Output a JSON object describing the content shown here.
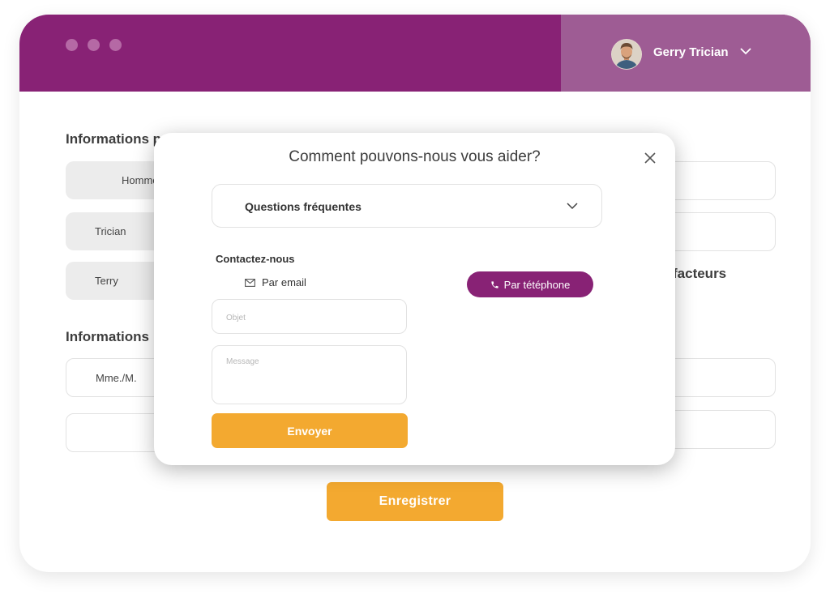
{
  "header": {
    "user_name": "Gerry Trician"
  },
  "form": {
    "section_personal_partial": "Informations p",
    "section_other_partial": "Informations",
    "section_right_partial": "facteurs",
    "fields": {
      "gender": "Homme",
      "last_name": "Trician",
      "first_name": "Terry",
      "civility": "Mme./M."
    },
    "save_label": "Enregistrer"
  },
  "modal": {
    "title": "Comment pouvons-nous vous aider?",
    "faq_label": "Questions fréquentes",
    "contact_title": "Contactez-nous",
    "email_tab_label": "Par email",
    "phone_button_label": "Par tétéphone",
    "subject_placeholder": "Objet",
    "message_placeholder": "Message",
    "send_label": "Envoyer"
  },
  "colors": {
    "primary": "#882275",
    "user_bar": "#9e5c94",
    "accent": "#f3a930"
  }
}
